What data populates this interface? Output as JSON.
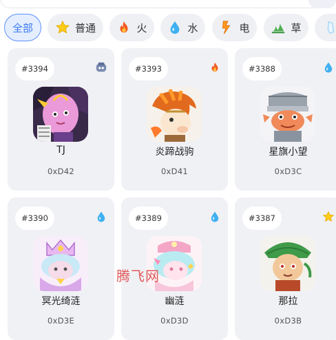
{
  "filters": [
    {
      "label": "全部",
      "icon": "",
      "active": true
    },
    {
      "label": "普通",
      "icon": "star-icon"
    },
    {
      "label": "火",
      "icon": "fire-icon"
    },
    {
      "label": "水",
      "icon": "water-drop-icon"
    },
    {
      "label": "电",
      "icon": "lightning-icon"
    },
    {
      "label": "草",
      "icon": "grass-icon"
    },
    {
      "label": "",
      "icon": "ice-crystal-icon"
    }
  ],
  "cards": [
    {
      "number": "#3394",
      "name": "TJ",
      "code": "0xD42",
      "type_icon": "ghost-type-icon"
    },
    {
      "number": "#3393",
      "name": "炎蹄战驹",
      "code": "0xD41",
      "type_icon": "fire-icon"
    },
    {
      "number": "#3388",
      "name": "星旗小望",
      "code": "0xD3C",
      "type_icon": "water-drop-icon"
    },
    {
      "number": "#3390",
      "name": "冥光绮涟",
      "code": "0xD3E",
      "type_icon": "water-drop-icon"
    },
    {
      "number": "#3389",
      "name": "幽涟",
      "code": "0xD3D",
      "type_icon": "water-drop-icon"
    },
    {
      "number": "#3387",
      "name": "那拉",
      "code": "0xD3B",
      "type_icon": "star-icon"
    }
  ],
  "watermark": "腾飞网",
  "colors": {
    "accent": "#3a78f2",
    "card_bg": "#f0f1f5",
    "chip_bg": "#eef0f4",
    "watermark": "#e05a5a"
  }
}
